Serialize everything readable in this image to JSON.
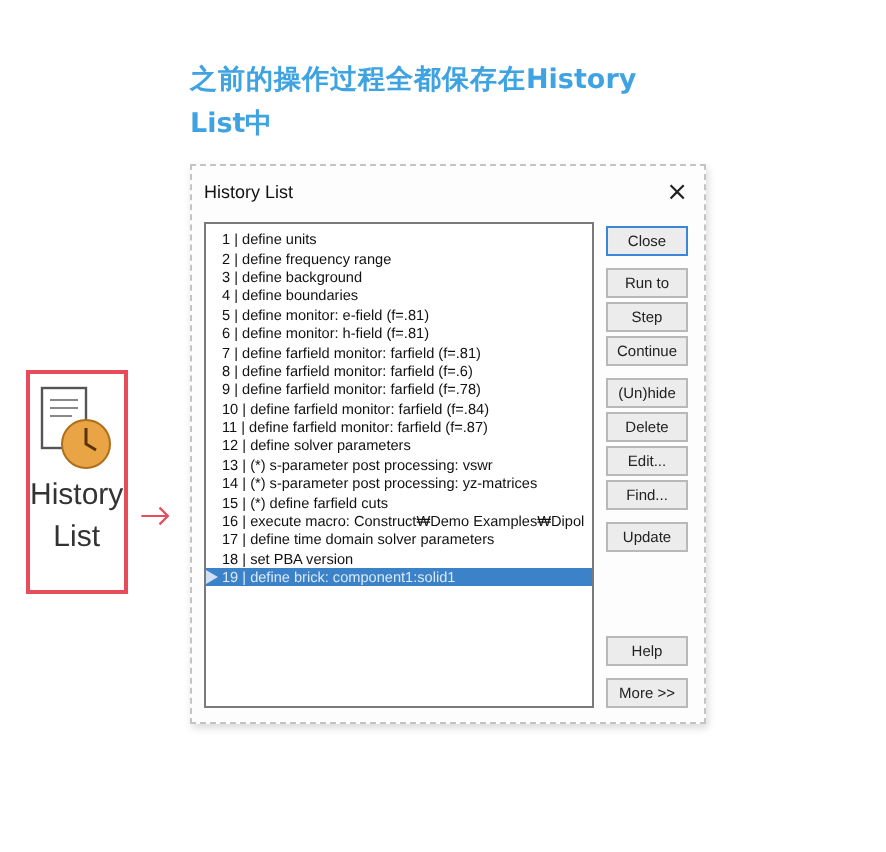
{
  "caption": "之前的操作过程全都保存在History List中",
  "ribbon_button": {
    "label_lines": [
      "History",
      "List"
    ]
  },
  "window": {
    "title": "History List",
    "close": "×"
  },
  "history": [
    {
      "text": "1 | define units",
      "selected": false
    },
    {
      "text": "2 | define frequency range",
      "selected": false
    },
    {
      "text": "3 | define background",
      "selected": false
    },
    {
      "text": "4 | define boundaries",
      "selected": false
    },
    {
      "text": "5 | define monitor: e-field (f=.81)",
      "selected": false
    },
    {
      "text": "6 | define monitor: h-field (f=.81)",
      "selected": false
    },
    {
      "text": "7 | define farfield monitor: farfield (f=.81)",
      "selected": false
    },
    {
      "text": "8 | define farfield monitor: farfield (f=.6)",
      "selected": false
    },
    {
      "text": "9 | define farfield monitor: farfield (f=.78)",
      "selected": false
    },
    {
      "text": "10 | define farfield monitor: farfield (f=.84)",
      "selected": false
    },
    {
      "text": "11 | define farfield monitor: farfield (f=.87)",
      "selected": false
    },
    {
      "text": "12 | define solver parameters",
      "selected": false
    },
    {
      "text": "13 | (*) s-parameter post processing: vswr",
      "selected": false
    },
    {
      "text": "14 | (*) s-parameter post processing: yz-matrices",
      "selected": false
    },
    {
      "text": "15 | (*) define farfield cuts",
      "selected": false
    },
    {
      "text": "16 | execute macro: Construct₩Demo Examples₩Dipol",
      "selected": false
    },
    {
      "text": "17 | define time domain solver parameters",
      "selected": false
    },
    {
      "text": "18 | set PBA version",
      "selected": false
    },
    {
      "text": "19 | define brick: component1:solid1",
      "selected": true
    }
  ],
  "button_groups": [
    [
      {
        "label": "Close",
        "default": true
      }
    ],
    [
      {
        "label": "Run to",
        "default": false
      },
      {
        "label": "Step",
        "default": false
      },
      {
        "label": "Continue",
        "default": false
      }
    ],
    [
      {
        "label": "(Un)hide",
        "default": false
      },
      {
        "label": "Delete",
        "default": false
      },
      {
        "label": "Edit...",
        "default": false
      },
      {
        "label": "Find...",
        "default": false
      }
    ],
    [
      {
        "label": "Update",
        "default": false
      }
    ]
  ],
  "bottom_buttons": [
    {
      "label": "Help",
      "default": false
    },
    {
      "label": "More >>",
      "default": false
    }
  ]
}
